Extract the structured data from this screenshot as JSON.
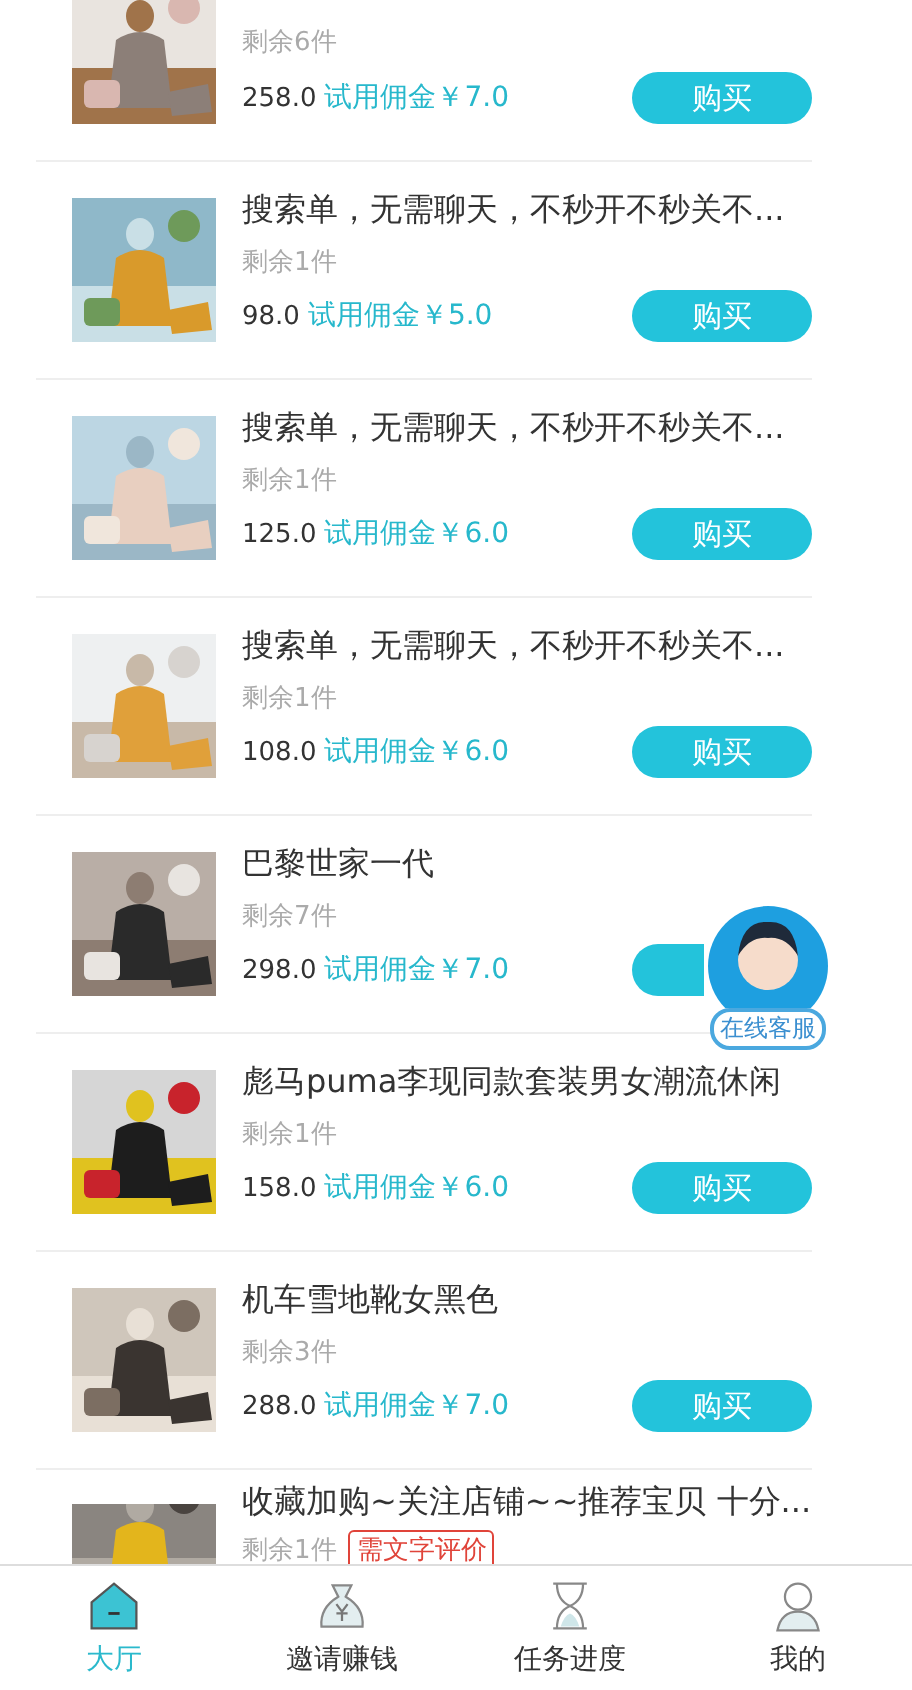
{
  "items": [
    {
      "kind": "picture",
      "remaining": "剩余6件",
      "price": "258.0",
      "commission": "试用佣金￥7.0",
      "button": "购买"
    },
    {
      "kind": "picture",
      "title": "搜索单，无需聊天，不秒开不秒关不...",
      "remaining": "剩余1件",
      "price": "98.0",
      "commission": "试用佣金￥5.0",
      "button": "购买"
    },
    {
      "kind": "picture",
      "title": "搜索单，无需聊天，不秒开不秒关不...",
      "remaining": "剩余1件",
      "price": "125.0",
      "commission": "试用佣金￥6.0",
      "button": "购买"
    },
    {
      "kind": "picture",
      "title": "搜索单，无需聊天，不秒开不秒关不...",
      "remaining": "剩余1件",
      "price": "108.0",
      "commission": "试用佣金￥6.0",
      "button": "购买"
    },
    {
      "kind": "picture",
      "title": "巴黎世家一代",
      "remaining": "剩余7件",
      "price": "298.0",
      "commission": "试用佣金￥7.0"
    },
    {
      "kind": "picture",
      "title": "彪马puma李现同款套装男女潮流休闲",
      "remaining": "剩余1件",
      "price": "158.0",
      "commission": "试用佣金￥6.0",
      "button": "购买"
    },
    {
      "kind": "picture",
      "title": "机车雪地靴女黑色",
      "remaining": "剩余3件",
      "price": "288.0",
      "commission": "试用佣金￥7.0",
      "button": "购买"
    },
    {
      "kind": "picture",
      "title": "收藏加购~关注店铺~~推荐宝贝 十分...",
      "remaining": "剩余1件",
      "tag": "需文字评价"
    }
  ],
  "service": {
    "label": "在线客服"
  },
  "tabs": [
    {
      "kind": "home",
      "label": "大厅",
      "selected": true
    },
    {
      "kind": "invite",
      "label": "邀请赚钱",
      "selected": false
    },
    {
      "kind": "progress",
      "label": "任务进度",
      "selected": false
    },
    {
      "kind": "me",
      "label": "我的",
      "selected": false
    }
  ]
}
